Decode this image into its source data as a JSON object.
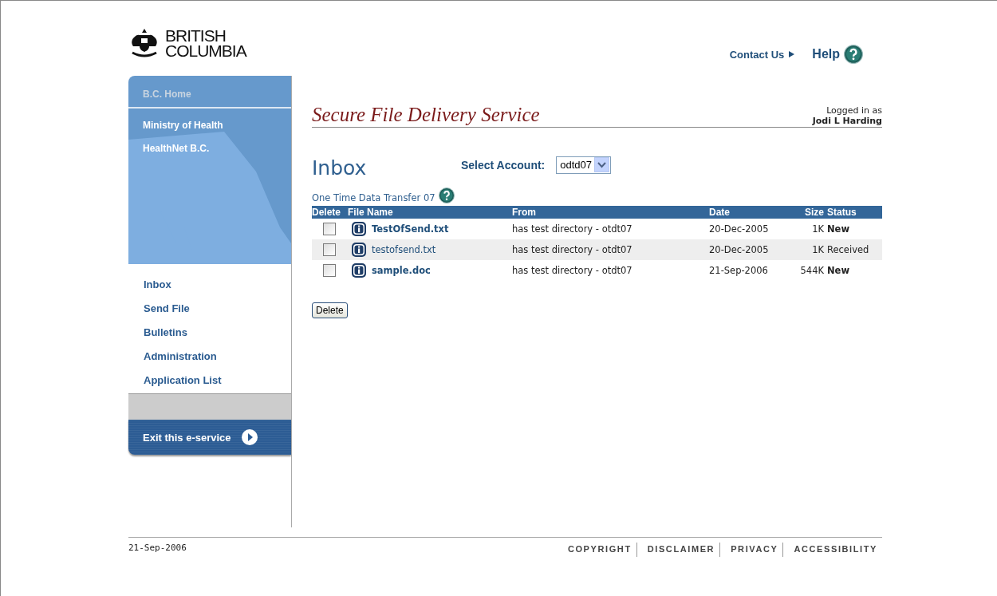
{
  "header": {
    "logo_lines": [
      "BRITISH",
      "COLUMBIA"
    ],
    "contact": "Contact Us",
    "help": "Help"
  },
  "sidebar": {
    "home": "B.C. Home",
    "top_links": [
      "Ministry of Health",
      "HealthNet B.C."
    ],
    "nav": [
      {
        "label": "Inbox"
      },
      {
        "label": "Send File"
      },
      {
        "label": "Bulletins"
      },
      {
        "label": "Administration"
      },
      {
        "label": "Application List"
      }
    ],
    "exit": "Exit this e-service"
  },
  "main": {
    "service_title": "Secure File Delivery Service",
    "logged_in_label": "Logged in as",
    "user": "Jodi L Harding",
    "heading": "Inbox",
    "account_label": "Select Account:",
    "account_value": "odtd07",
    "account_name": "One Time Data Transfer 07",
    "table": {
      "columns": [
        "Delete",
        "File Name",
        "From",
        "Date",
        "Size",
        "Status"
      ],
      "rows": [
        {
          "checked": false,
          "file": "TestOfSend.txt",
          "from": "has test directory - otdt07",
          "date": "20-Dec-2005",
          "size": "1K",
          "status": "New",
          "unread": true
        },
        {
          "checked": false,
          "file": "testofsend.txt",
          "from": "has test directory - otdt07",
          "date": "20-Dec-2005",
          "size": "1K",
          "status": "Received",
          "unread": false
        },
        {
          "checked": false,
          "file": "sample.doc",
          "from": "has test directory - otdt07",
          "date": "21-Sep-2006",
          "size": "544K",
          "status": "New",
          "unread": true
        }
      ]
    },
    "delete_button": "Delete"
  },
  "footer": {
    "date": "21-Sep-2006",
    "links": [
      "COPYRIGHT",
      "DISCLAIMER",
      "PRIVACY",
      "ACCESSIBILITY"
    ]
  }
}
